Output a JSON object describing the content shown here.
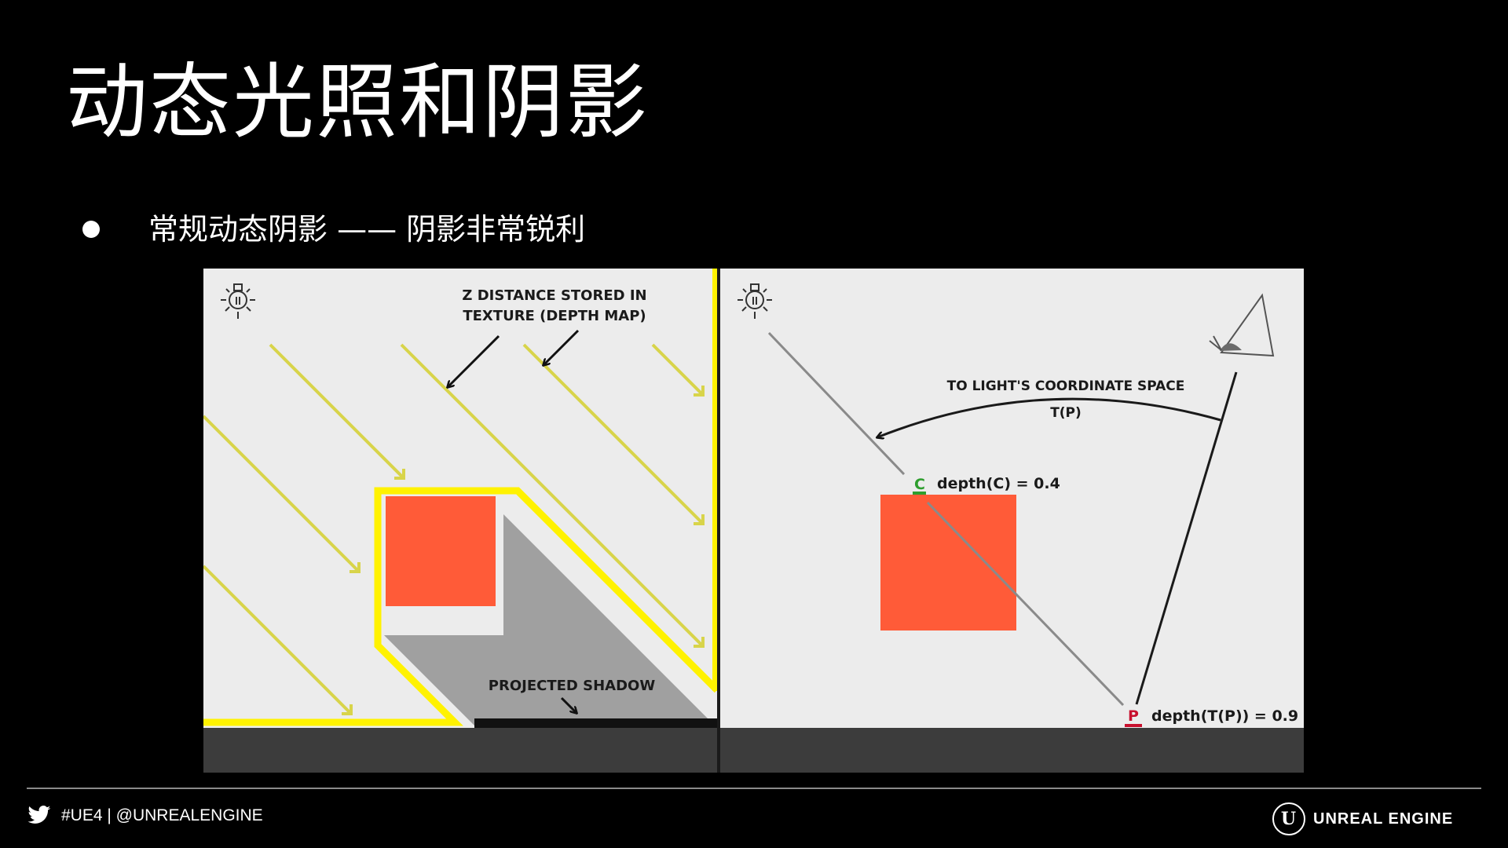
{
  "slide": {
    "title": "动态光照和阴影",
    "bullet": "常规动态阴影 —— 阴影非常锐利"
  },
  "diagram": {
    "left_panel": {
      "label_top_line1": "Z DISTANCE STORED IN",
      "label_top_line2": "TEXTURE (DEPTH MAP)",
      "label_shadow": "PROJECTED SHADOW"
    },
    "right_panel": {
      "label_transform_line1": "TO LIGHT'S COORDINATE SPACE",
      "label_transform_line2": "T(P)",
      "point_c_letter": "C",
      "point_c_depth": "depth(C) = 0.4",
      "point_p_letter": "P",
      "point_p_depth": "depth(T(P)) = 0.9"
    },
    "colors": {
      "light_ray": "#f5f03a",
      "object": "#ff5b38",
      "shadow": "#a0a0a0",
      "panel_bg": "#ececec",
      "floor": "#3c3c3c",
      "point_c": "#2e9e2e",
      "point_p": "#c8102e"
    }
  },
  "footer": {
    "social": "#UE4 | @UNREALENGINE",
    "brand": "UNREAL ENGINE",
    "icons": [
      "twitter-bird-icon",
      "unreal-logo-icon"
    ]
  }
}
